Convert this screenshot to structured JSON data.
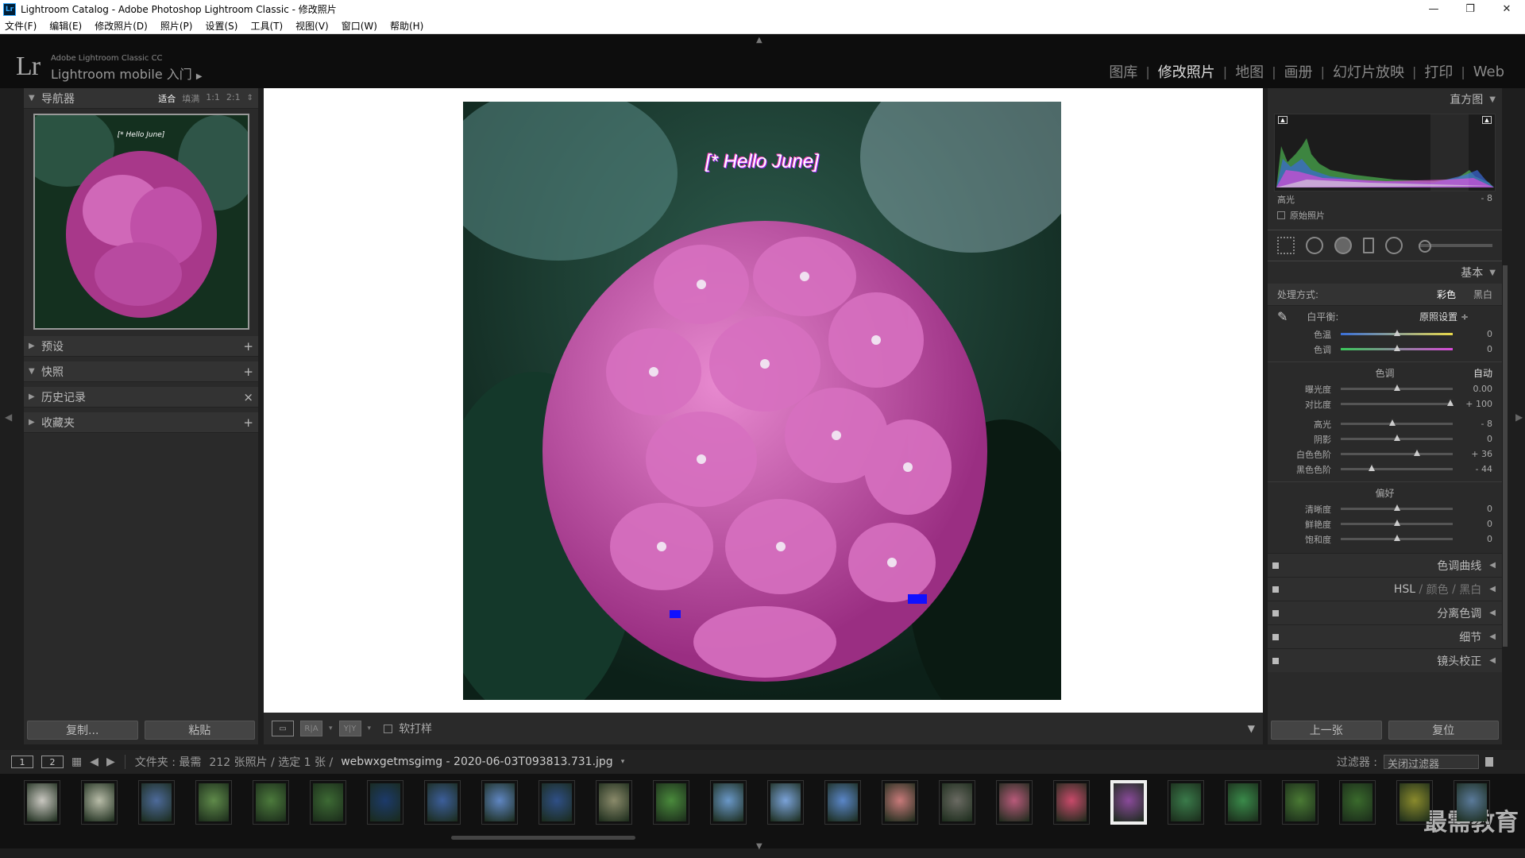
{
  "window": {
    "title": "Lightroom Catalog - Adobe Photoshop Lightroom Classic - 修改照片",
    "icon": "Lr"
  },
  "menu": [
    "文件(F)",
    "编辑(E)",
    "修改照片(D)",
    "照片(P)",
    "设置(S)",
    "工具(T)",
    "视图(V)",
    "窗口(W)",
    "帮助(H)"
  ],
  "brand": {
    "logo": "Lr",
    "line1": "Adobe Lightroom Classic CC",
    "line2": "Lightroom mobile 入门"
  },
  "modules": [
    {
      "label": "图库",
      "active": false
    },
    {
      "label": "修改照片",
      "active": true
    },
    {
      "label": "地图",
      "active": false
    },
    {
      "label": "画册",
      "active": false
    },
    {
      "label": "幻灯片放映",
      "active": false
    },
    {
      "label": "打印",
      "active": false
    },
    {
      "label": "Web",
      "active": false
    }
  ],
  "navigator": {
    "title": "导航器",
    "options": [
      "适合",
      "填满",
      "1:1",
      "2:1"
    ],
    "active_option": "适合"
  },
  "left_panels": [
    {
      "label": "预设",
      "action": "+"
    },
    {
      "label": "快照",
      "action": "+"
    },
    {
      "label": "历史记录",
      "action": "×"
    },
    {
      "label": "收藏夹",
      "action": "+"
    }
  ],
  "left_buttons": {
    "copy": "复制...",
    "paste": "粘贴"
  },
  "photo": {
    "caption": "[* Hello June]",
    "thumb_caption": "[* Hello June]"
  },
  "toolbar": {
    "soft_proof": "软打样",
    "ref_view": "R|A",
    "before_after": "Y|Y"
  },
  "histogram": {
    "title": "直方图",
    "label": "高光",
    "value": "- 8",
    "original": "原始照片"
  },
  "basic": {
    "title": "基本",
    "treatment_label": "处理方式:",
    "treatment_options": [
      "彩色",
      "黑白"
    ],
    "wb_label": "白平衡:",
    "wb_value": "原照设置 ÷",
    "wb_sliders": [
      {
        "label": "色温",
        "value": "0",
        "pos": 0.5,
        "gradient": "linear-gradient(90deg,#3a6fd8,#e8d84a)"
      },
      {
        "label": "色调",
        "value": "0",
        "pos": 0.5,
        "gradient": "linear-gradient(90deg,#3ac85a,#d84ad8)"
      }
    ],
    "tone_head": "色调",
    "tone_auto": "自动",
    "tone_sliders": [
      {
        "label": "曝光度",
        "value": "0.00",
        "pos": 0.5
      },
      {
        "label": "对比度",
        "value": "+ 100",
        "pos": 0.98
      }
    ],
    "tone_sliders2": [
      {
        "label": "高光",
        "value": "- 8",
        "pos": 0.46
      },
      {
        "label": "阴影",
        "value": "0",
        "pos": 0.5
      },
      {
        "label": "白色色阶",
        "value": "+ 36",
        "pos": 0.68
      },
      {
        "label": "黑色色阶",
        "value": "- 44",
        "pos": 0.28
      }
    ],
    "presence_head": "偏好",
    "presence_sliders": [
      {
        "label": "清晰度",
        "value": "0",
        "pos": 0.5
      },
      {
        "label": "鲜艳度",
        "value": "0",
        "pos": 0.5
      },
      {
        "label": "饱和度",
        "value": "0",
        "pos": 0.5
      }
    ]
  },
  "collapsed_panels": [
    "色调曲线",
    "HSL / 颜色 / 黑白",
    "分离色调",
    "细节",
    "镜头校正"
  ],
  "hsl": {
    "a": "HSL",
    "b": "颜色",
    "c": "黑白"
  },
  "right_buttons": {
    "prev": "上一张",
    "reset": "复位"
  },
  "filmbar": {
    "box1": "1",
    "box2": "2",
    "folder": "文件夹 : 最需",
    "count": "212 张照片 / 选定 1 张 /",
    "filename": "webwxgetmsgimg - 2020-06-03T093813.731.jpg",
    "filter_label": "过滤器 :",
    "filter_value": "关闭过滤器"
  },
  "thumbnails": [
    {
      "color": "#c9c7c0"
    },
    {
      "color": "#b8bca8"
    },
    {
      "color": "#4d6a9a"
    },
    {
      "color": "#5f8a4a"
    },
    {
      "color": "#4c7a3c"
    },
    {
      "color": "#3d6a34"
    },
    {
      "color": "#1c3a6a"
    },
    {
      "color": "#3c5e9a"
    },
    {
      "color": "#5f86c2"
    },
    {
      "color": "#2f4f86"
    },
    {
      "color": "#8a8a6a"
    },
    {
      "color": "#4a8a3c"
    },
    {
      "color": "#6a98c8"
    },
    {
      "color": "#7aa2d8"
    },
    {
      "color": "#5a86c8"
    },
    {
      "color": "#c87a7a"
    },
    {
      "color": "#6a6a62"
    },
    {
      "color": "#b85a7a"
    },
    {
      "color": "#c84a6a"
    },
    {
      "color": "#8a4a9a"
    },
    {
      "color": "#3a7a4a"
    },
    {
      "color": "#3a8a4a"
    },
    {
      "color": "#4a7a34"
    },
    {
      "color": "#3a6a2c"
    },
    {
      "color": "#8a8a2c"
    },
    {
      "color": "#5a7a9a"
    }
  ],
  "watermark": "最需教育"
}
